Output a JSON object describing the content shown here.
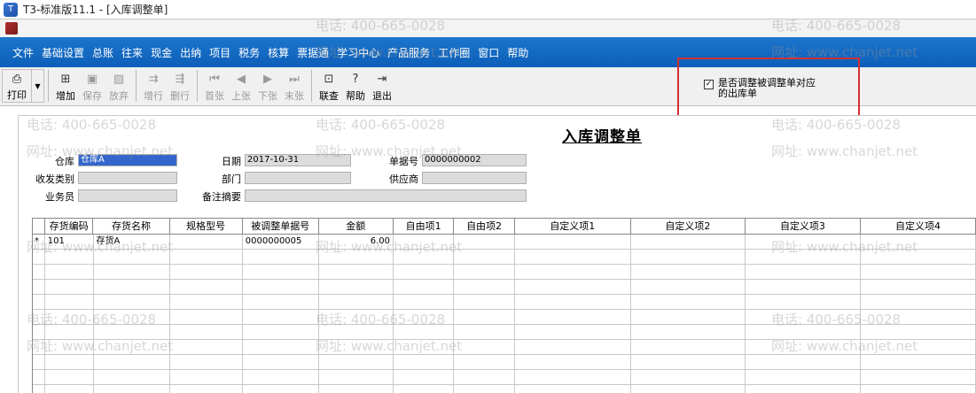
{
  "window": {
    "title": "T3-标准版11.1 - [入库调整单]"
  },
  "menu": [
    "文件",
    "基础设置",
    "总账",
    "往来",
    "现金",
    "出纳",
    "项目",
    "税务",
    "核算",
    "票据通",
    "学习中心",
    "产品服务",
    "工作圈",
    "窗口",
    "帮助"
  ],
  "toolbar": {
    "print": "打印",
    "add": "增加",
    "save": "保存",
    "discard": "放弃",
    "add_row": "增行",
    "delete_row": "删行",
    "first": "首张",
    "prev": "上张",
    "next": "下张",
    "last": "末张",
    "link": "联查",
    "help": "帮助",
    "exit": "退出"
  },
  "option": {
    "label": "是否调整被调整单对应的出库单",
    "checked": true
  },
  "doc": {
    "title": "入库调整单",
    "warehouse_label": "仓库",
    "warehouse_value": "仓库A",
    "date_label": "日期",
    "date_value": "2017-10-31",
    "docno_label": "单据号",
    "docno_value": "0000000002",
    "category_label": "收发类别",
    "dept_label": "部门",
    "supplier_label": "供应商",
    "clerk_label": "业务员",
    "remark_label": "备注摘要"
  },
  "grid": {
    "headers": [
      "存货编码",
      "存货名称",
      "规格型号",
      "被调整单据号",
      "金额",
      "自由项1",
      "自由项2",
      "自定义项1",
      "自定义项2",
      "自定义项3",
      "自定义项4"
    ],
    "rows": [
      {
        "marker": "*",
        "cells": [
          "101",
          "存货A",
          "",
          "0000000005",
          "6.00",
          "",
          "",
          "",
          "",
          "",
          ""
        ]
      }
    ]
  },
  "watermark": {
    "phone": "电话: 400-665-0028",
    "site": "网址: www.chanjet.net"
  },
  "colors": {
    "menubar": "#0d5fb8",
    "highlight": "#d43030",
    "selection": "#3366cc"
  }
}
